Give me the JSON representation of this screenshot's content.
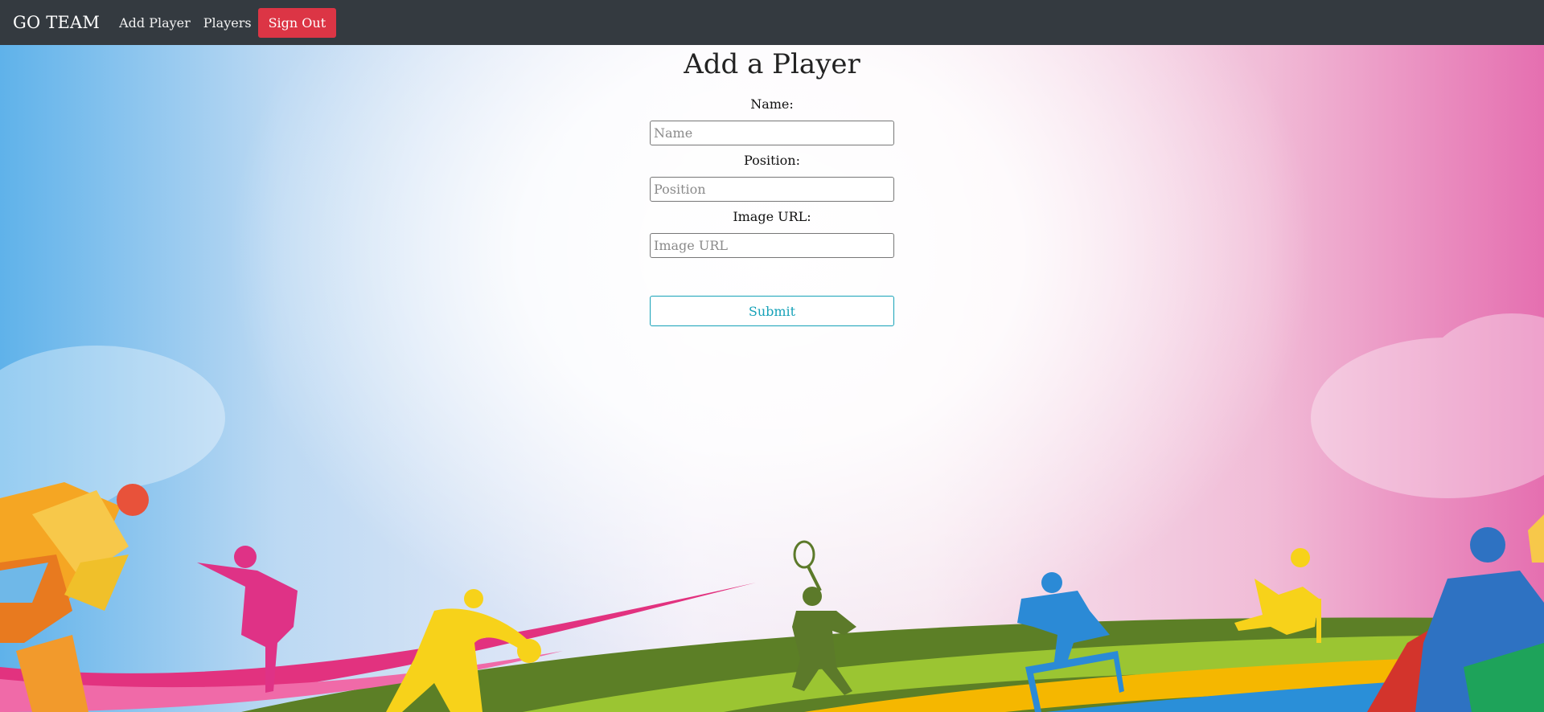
{
  "navbar": {
    "brand": "GO TEAM",
    "links": [
      "Add Player",
      "Players"
    ],
    "signout_label": "Sign Out"
  },
  "form": {
    "title": "Add a Player",
    "name_label": "Name:",
    "name_placeholder": "Name",
    "position_label": "Position:",
    "position_placeholder": "Position",
    "image_label": "Image URL:",
    "image_placeholder": "Image URL",
    "submit_label": "Submit"
  },
  "colors": {
    "navbar": "#343a40",
    "signout": "#dc3545",
    "submit_accent": "#17a2b8"
  }
}
